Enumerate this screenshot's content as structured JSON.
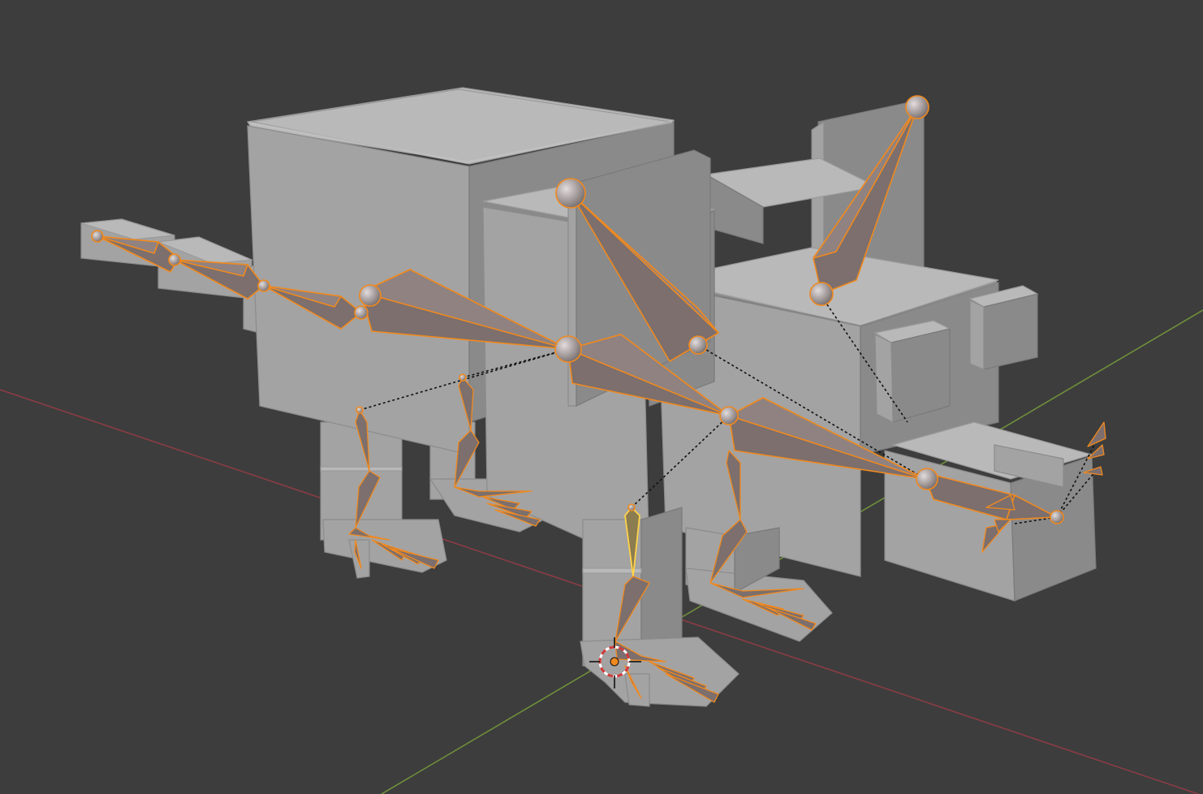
{
  "viewport": {
    "background_color": "#3d3d3d",
    "x_axis_color": "#8a3c45",
    "y_axis_color": "#6e8f3a"
  },
  "scene": {
    "mesh_color": "#a3a3a3",
    "bone_fill_color": "#7c6f6d",
    "bone_outline_color": "#f0891f",
    "active_bone_outline_color": "#ffd24a",
    "relationship_line_color": "#111111"
  },
  "icons": {
    "cursor": "3d-cursor-icon"
  }
}
